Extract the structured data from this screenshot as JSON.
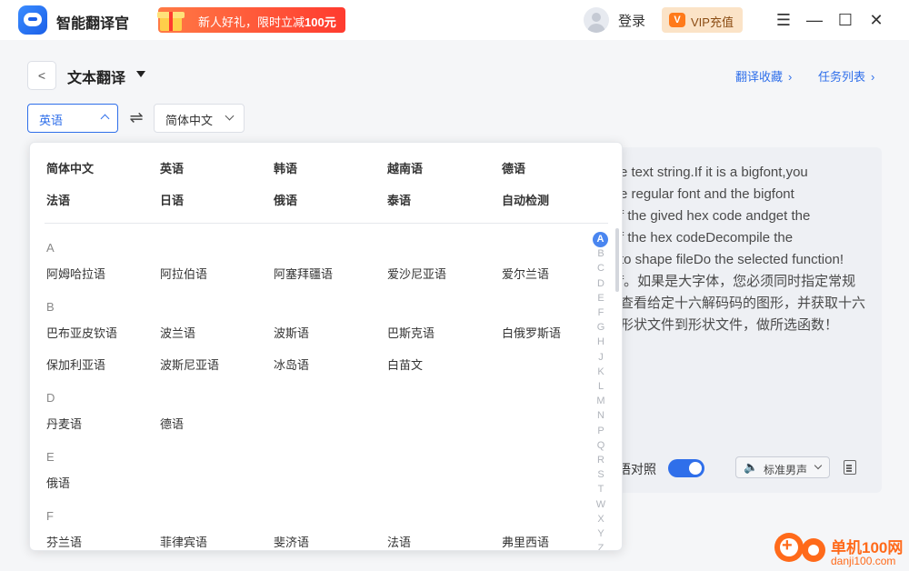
{
  "app": {
    "name": "智能翻译官"
  },
  "promo": {
    "text_prefix": "新人好礼，限时立减",
    "amount": "100元"
  },
  "header": {
    "login_label": "登录",
    "vip_label": "VIP充值",
    "vip_icon_text": "V"
  },
  "page": {
    "title": "文本翻译",
    "links": [
      {
        "label": "翻译收藏"
      },
      {
        "label": "任务列表"
      }
    ]
  },
  "lang_select": {
    "source": "英语",
    "target": "简体中文"
  },
  "text_panel": {
    "lines": [
      "e text string.If it is a bigfont,you",
      "e regular font and the bigfont",
      "f the gived hex code andget the",
      "f the hex codeDecompile the",
      "to shape fileDo the selected function!",
      "f。如果是大字体，您必须同时指定常规",
      "查看给定十六解码码的图形，并获取十六",
      "形状文件到形状文件，做所选函数！"
    ],
    "bilingual_label": "语对照",
    "bilingual_on": true,
    "voice": "标准男声"
  },
  "dropdown": {
    "common": [
      "简体中文",
      "英语",
      "韩语",
      "越南语",
      "德语",
      "法语",
      "日语",
      "俄语",
      "泰语",
      "自动检测"
    ],
    "groups": [
      {
        "letter": "A",
        "items": [
          "阿姆哈拉语",
          "阿拉伯语",
          "阿塞拜疆语",
          "爱沙尼亚语",
          "爱尔兰语"
        ]
      },
      {
        "letter": "B",
        "items": [
          "巴布亚皮钦语",
          "波兰语",
          "波斯语",
          "巴斯克语",
          "白俄罗斯语",
          "保加利亚语",
          "波斯尼亚语",
          "冰岛语",
          "白苗文"
        ]
      },
      {
        "letter": "D",
        "items": [
          "丹麦语",
          "德语"
        ]
      },
      {
        "letter": "E",
        "items": [
          "俄语"
        ]
      },
      {
        "letter": "F",
        "items": [
          "芬兰语",
          "菲律宾语",
          "斐济语",
          "法语",
          "弗里西语"
        ]
      }
    ],
    "alphabet": [
      "A",
      "B",
      "C",
      "D",
      "E",
      "F",
      "G",
      "H",
      "J",
      "K",
      "L",
      "M",
      "N",
      "P",
      "Q",
      "R",
      "S",
      "T",
      "W",
      "X",
      "Y",
      "Z"
    ],
    "active_letter": "A"
  },
  "watermark": {
    "name": "单机100网",
    "url": "danji100.com"
  },
  "colors": {
    "accent": "#2f6fea",
    "promo": "#ff3b2f",
    "vip_bg": "#fbe3c7"
  }
}
